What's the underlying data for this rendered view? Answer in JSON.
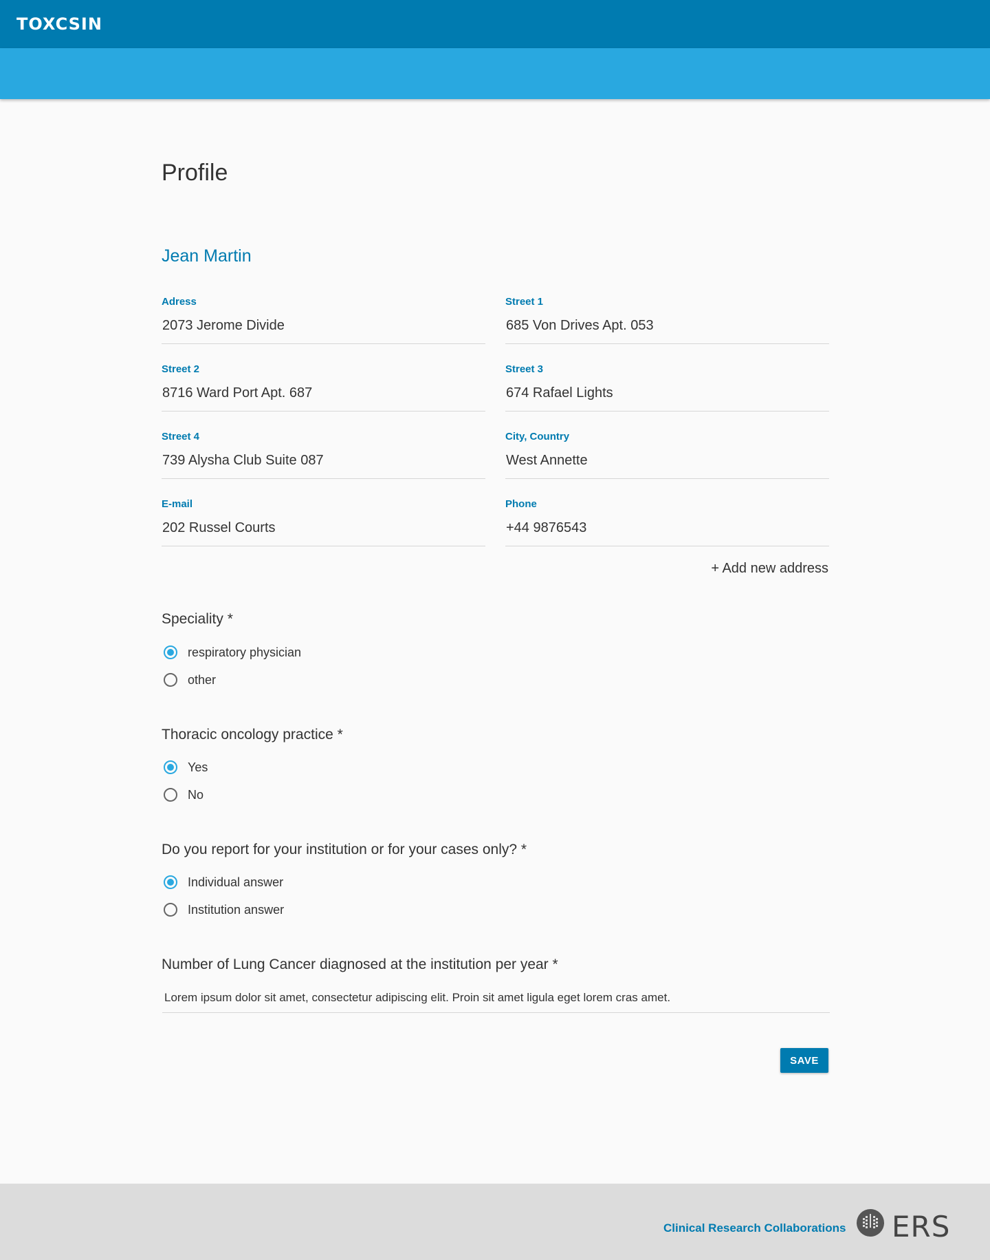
{
  "header": {
    "logo_text": "TOXCSIN"
  },
  "page": {
    "title": "Profile",
    "user_name": "Jean Martin"
  },
  "fields": [
    {
      "label": "Adress",
      "value": "2073 Jerome Divide"
    },
    {
      "label": "Street 1",
      "value": "685 Von Drives Apt. 053"
    },
    {
      "label": "Street 2",
      "value": "8716 Ward Port Apt. 687"
    },
    {
      "label": "Street 3",
      "value": "674 Rafael Lights"
    },
    {
      "label": "Street 4",
      "value": "739 Alysha Club Suite 087"
    },
    {
      "label": "City, Country",
      "value": "West Annette"
    },
    {
      "label": "E-mail",
      "value": "202 Russel Courts"
    },
    {
      "label": "Phone",
      "value": "+44 9876543"
    }
  ],
  "add_address_label": "+ Add new address",
  "questions": {
    "speciality": {
      "label": "Speciality *",
      "options": [
        {
          "label": "respiratory physician",
          "selected": true
        },
        {
          "label": "other",
          "selected": false
        }
      ]
    },
    "thoracic": {
      "label": "Thoracic oncology practice *",
      "options": [
        {
          "label": "Yes",
          "selected": true
        },
        {
          "label": "No",
          "selected": false
        }
      ]
    },
    "report": {
      "label": "Do you report for your institution or for your cases only? *",
      "options": [
        {
          "label": "Individual answer",
          "selected": true
        },
        {
          "label": "Institution answer",
          "selected": false
        }
      ]
    },
    "lung_cancer": {
      "label": "Number of Lung Cancer diagnosed at the institution per year *",
      "value": "Lorem ipsum dolor sit amet, consectetur adipiscing elit. Proin sit amet ligula eget lorem cras amet."
    }
  },
  "save_label": "SAVE",
  "footer": {
    "link_label": "Clinical Research Collaborations",
    "brand_text": "ERS"
  },
  "colors": {
    "primary": "#007bb0",
    "secondary": "#29a8e0",
    "background": "#fafafa",
    "footer": "#dcdcdc"
  }
}
